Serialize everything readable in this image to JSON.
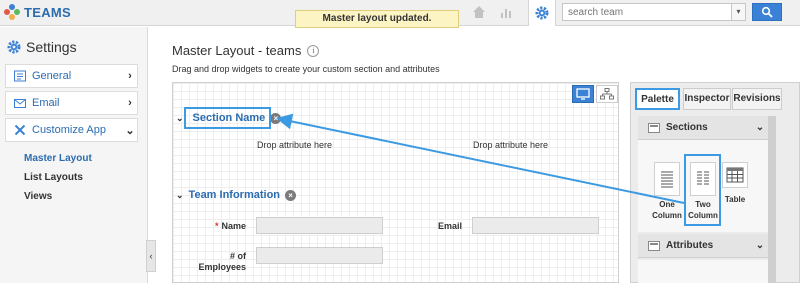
{
  "app": {
    "title": "TEAMS"
  },
  "toast": {
    "text": "Master layout updated."
  },
  "search": {
    "placeholder": "search team",
    "dropdown_glyph": "▾"
  },
  "sidebar": {
    "heading": "Settings",
    "items": [
      {
        "label": "General",
        "icon": "form-icon",
        "expanded": false
      },
      {
        "label": "Email",
        "icon": "envelope-icon",
        "expanded": false
      },
      {
        "label": "Customize App",
        "icon": "tools-icon",
        "expanded": true
      }
    ],
    "subitems": [
      {
        "label": "Master Layout",
        "active": true
      },
      {
        "label": "List Layouts",
        "active": false
      },
      {
        "label": "Views",
        "active": false
      }
    ],
    "collapse_glyph": "‹"
  },
  "main": {
    "title": "Master Layout - teams",
    "subtitle": "Drag and drop widgets to create your custom section and attributes"
  },
  "sections": [
    {
      "name": "Section Name",
      "drop_left": "Drop attribute here",
      "drop_right": "Drop attribute here"
    },
    {
      "name": "Team Information",
      "fields": [
        {
          "label": "Name",
          "required": true
        },
        {
          "label": "Email",
          "required": false
        },
        {
          "label_line1": "# of",
          "label_line2": "Employees",
          "required": false
        }
      ]
    }
  ],
  "panel": {
    "tabs": [
      "Palette",
      "Inspector",
      "Revisions"
    ],
    "active_tab": "Palette",
    "sections_header": "Sections",
    "attributes_header": "Attributes",
    "widgets": [
      {
        "line1": "One",
        "line2": "Column"
      },
      {
        "line1": "Two",
        "line2": "Column"
      },
      {
        "line1": "Table",
        "line2": ""
      }
    ]
  },
  "colors": {
    "accent": "#3b82d6",
    "highlight": "#3b9ae1",
    "brand_text": "#2b6cb0",
    "toast_bg": "#fdf4c4"
  }
}
